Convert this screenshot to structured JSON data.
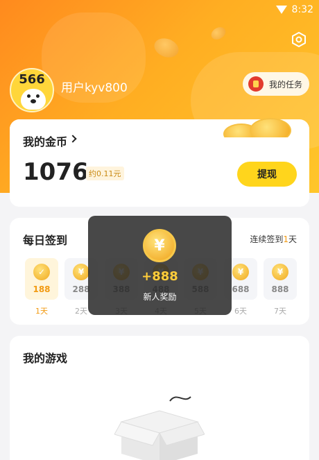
{
  "status_bar": {
    "time": "8:32"
  },
  "profile": {
    "avatar_text": "566",
    "username": "用户kyv800",
    "task_button": "我的任务"
  },
  "coins": {
    "title": "我的金币",
    "value": "1076",
    "approx": "约0.11元",
    "withdraw_label": "提现"
  },
  "signin": {
    "title": "每日签到",
    "streak_prefix": "连续签到",
    "streak_days": "1",
    "streak_suffix": "天",
    "days": [
      {
        "amount": "188",
        "label": "1天",
        "active": true
      },
      {
        "amount": "288",
        "label": "2天",
        "active": false
      },
      {
        "amount": "388",
        "label": "3天",
        "active": false
      },
      {
        "amount": "488",
        "label": "4天",
        "active": false
      },
      {
        "amount": "588",
        "label": "5天",
        "active": false
      },
      {
        "amount": "688",
        "label": "6天",
        "active": false
      },
      {
        "amount": "888",
        "label": "7天",
        "active": false
      }
    ],
    "coin_symbol": "¥"
  },
  "games": {
    "title": "我的游戏"
  },
  "toast": {
    "amount": "+888",
    "label": "新人奖励",
    "coin_symbol": "¥"
  },
  "colors": {
    "accent": "#ffd51c",
    "header_start": "#ff8a1e",
    "header_end": "#ffc62a",
    "highlight": "#f29a12"
  }
}
